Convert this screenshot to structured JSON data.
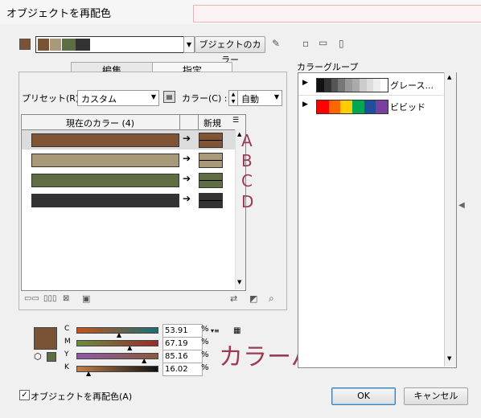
{
  "window": {
    "title": "オブジェクトを再配色"
  },
  "top": {
    "current_color": "#7a5236",
    "swatch_colors": [
      "#7a5236",
      "#a8997a",
      "#5e6e44",
      "#333333"
    ],
    "group_button": "ブジェクトのカラー"
  },
  "tabs": {
    "edit": "編集",
    "assign": "指定"
  },
  "preset": {
    "label": "プリセット(R) :",
    "value": "カスタム"
  },
  "colors_setting": {
    "label": "カラー(C) :",
    "value": "自動"
  },
  "table": {
    "header_current": "現在のカラー (4)",
    "header_new": "新規",
    "rows": [
      {
        "color": "#7f5536",
        "letter": "A"
      },
      {
        "color": "#a89a78",
        "letter": "B"
      },
      {
        "color": "#5f6d44",
        "letter": "C"
      },
      {
        "color": "#333333",
        "letter": "D"
      }
    ]
  },
  "cmyk": {
    "C": {
      "label": "C",
      "value": "53.91",
      "unit": "%",
      "fill": 0.5391
    },
    "M": {
      "label": "M",
      "value": "67.19",
      "unit": "%",
      "fill": 0.6719
    },
    "Y": {
      "label": "Y",
      "value": "85.16",
      "unit": "%",
      "fill": 0.8516
    },
    "K": {
      "label": "K",
      "value": "16.02",
      "unit": "%",
      "fill": 0.1602
    }
  },
  "annotation": "カラーパレット",
  "right_panel": {
    "title": "カラーグループ",
    "groups": [
      {
        "label": "グレース...",
        "colors": [
          "#111111",
          "#333333",
          "#555555",
          "#777777",
          "#999999",
          "#aaaaaa",
          "#cccccc",
          "#dddddd",
          "#eeeeee",
          "#ffffff"
        ]
      },
      {
        "label": "ビビッド",
        "colors": [
          "#ff0000",
          "#ff6600",
          "#ffcc00",
          "#00a651",
          "#1f4e9c",
          "#7b3fa0"
        ]
      }
    ]
  },
  "recolor_checkbox": {
    "label": "オブジェクトを再配色(A)",
    "checked": true
  },
  "buttons": {
    "ok": "OK",
    "cancel": "キャンセル"
  }
}
